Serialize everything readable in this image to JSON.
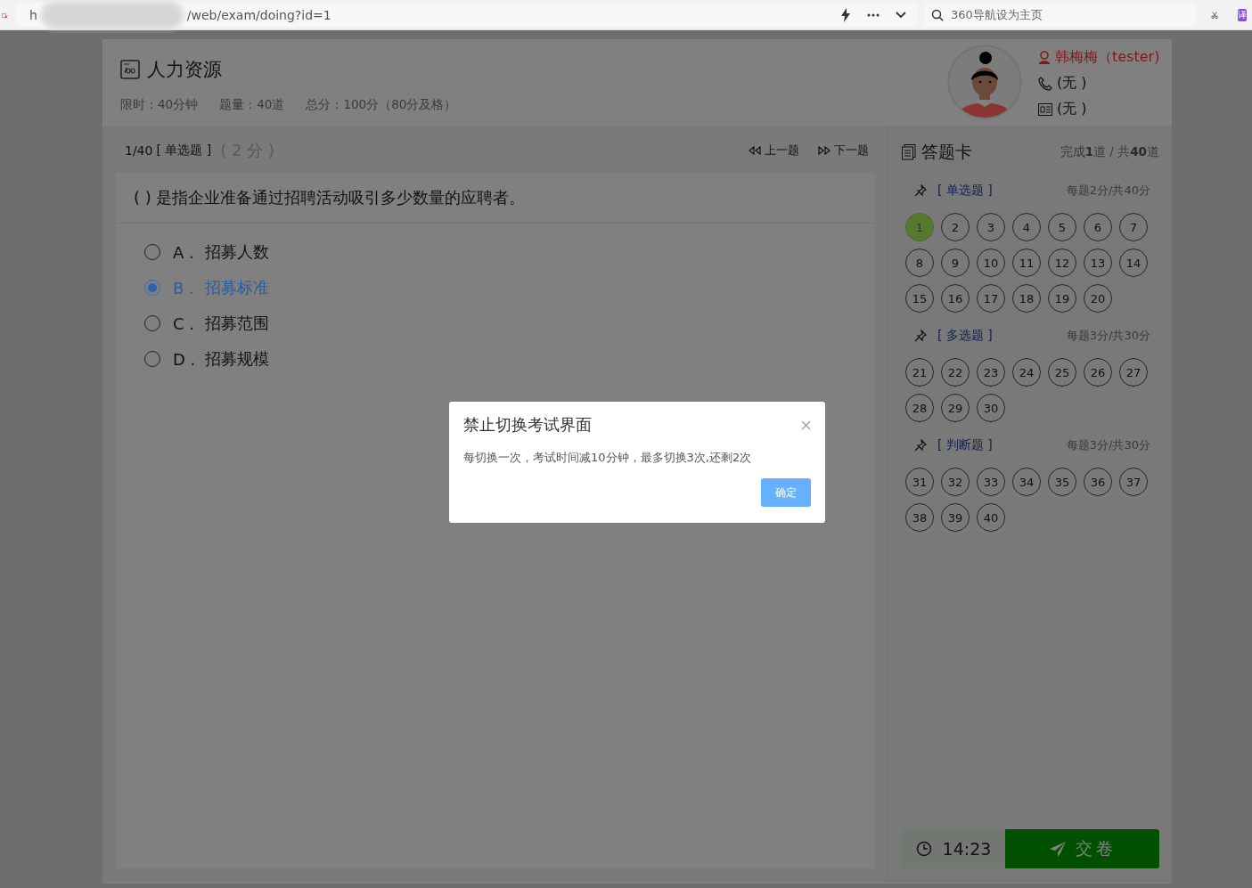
{
  "browser": {
    "url_start": "h",
    "url_path": "/web/exam/doing?id=1",
    "search_placeholder": "360导航设为主页",
    "translate_label": "译"
  },
  "exam": {
    "title": "人力资源",
    "meta": [
      "限时：40分钟",
      "题量：40道",
      "总分：100分（80分及格）"
    ]
  },
  "user": {
    "name": "韩梅梅（tester)",
    "phone": "(无 )",
    "id_card": "(无 )"
  },
  "question": {
    "progress": "1/40",
    "type": "[ 单选题 ]",
    "score": "( 2 分 )",
    "prev": "上一题",
    "next": "下一题",
    "text": "(    ) 是指企业准备通过招聘活动吸引多少数量的应聘者。",
    "options": [
      {
        "letter": "A .",
        "text": "招募人数",
        "selected": false
      },
      {
        "letter": "B .",
        "text": "招募标准",
        "selected": true
      },
      {
        "letter": "C .",
        "text": "招募范围",
        "selected": false
      },
      {
        "letter": "D .",
        "text": "招募规模",
        "selected": false
      }
    ]
  },
  "answer_card": {
    "title": "答题卡",
    "progress": "完成**1**道 / 共**40**道",
    "sections": [
      {
        "name": "[ 单选题 ]",
        "scoring": "每题2分/共40分",
        "items": [
          {
            "label": "1",
            "answered": true
          },
          {
            "label": "2",
            "answered": false
          },
          {
            "label": "3",
            "answered": false
          },
          {
            "label": "4",
            "answered": false
          },
          {
            "label": "5",
            "answered": false
          },
          {
            "label": "6",
            "answered": false
          },
          {
            "label": "7",
            "answered": false
          },
          {
            "label": "8",
            "answered": false
          },
          {
            "label": "9",
            "answered": false
          },
          {
            "label": "10",
            "answered": false
          },
          {
            "label": "11",
            "answered": false
          },
          {
            "label": "12",
            "answered": false
          },
          {
            "label": "13",
            "answered": false
          },
          {
            "label": "14",
            "answered": false
          },
          {
            "label": "15",
            "answered": false
          },
          {
            "label": "16",
            "answered": false
          },
          {
            "label": "17",
            "answered": false
          },
          {
            "label": "18",
            "answered": false
          },
          {
            "label": "19",
            "answered": false
          },
          {
            "label": "20",
            "answered": false
          }
        ]
      },
      {
        "name": "[ 多选题 ]",
        "scoring": "每题3分/共30分",
        "items": [
          {
            "label": "21",
            "answered": false
          },
          {
            "label": "22",
            "answered": false
          },
          {
            "label": "23",
            "answered": false
          },
          {
            "label": "24",
            "answered": false
          },
          {
            "label": "25",
            "answered": false
          },
          {
            "label": "26",
            "answered": false
          },
          {
            "label": "27",
            "answered": false
          },
          {
            "label": "28",
            "answered": false
          },
          {
            "label": "29",
            "answered": false
          },
          {
            "label": "30",
            "answered": false
          }
        ]
      },
      {
        "name": "[ 判断题 ]",
        "scoring": "每题3分/共30分",
        "items": [
          {
            "label": "31",
            "answered": false
          },
          {
            "label": "32",
            "answered": false
          },
          {
            "label": "33",
            "answered": false
          },
          {
            "label": "34",
            "answered": false
          },
          {
            "label": "35",
            "answered": false
          },
          {
            "label": "36",
            "answered": false
          },
          {
            "label": "37",
            "answered": false
          },
          {
            "label": "38",
            "answered": false
          },
          {
            "label": "39",
            "answered": false
          },
          {
            "label": "40",
            "answered": false
          }
        ]
      }
    ],
    "timer": "14:23",
    "submit": "交卷"
  },
  "dialog": {
    "title": "禁止切换考试界面",
    "message": "每切换一次，考试时间减10分钟，最多切换3次,还剩2次",
    "confirm": "确定"
  }
}
